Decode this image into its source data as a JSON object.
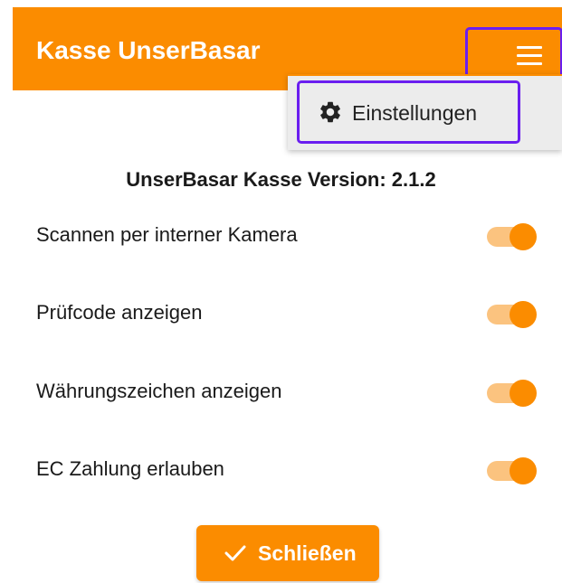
{
  "app_bar": {
    "title": "Kasse UnserBasar",
    "menu_icon": "hamburger-menu-icon",
    "color": "#fb8c00"
  },
  "menu": {
    "items": [
      {
        "icon": "gear-icon",
        "label": "Einstellungen"
      }
    ]
  },
  "version_text": "UnserBasar Kasse Version: 2.1.2",
  "settings": [
    {
      "label": "Scannen per interner Kamera",
      "enabled": true
    },
    {
      "label": "Prüfcode anzeigen",
      "enabled": true
    },
    {
      "label": "Währungszeichen anzeigen",
      "enabled": true
    },
    {
      "label": "EC Zahlung erlauben",
      "enabled": true
    }
  ],
  "close_button": {
    "icon": "check-icon",
    "label": "Schließen"
  },
  "colors": {
    "accent": "#fb8c00",
    "toggle_track": "#fbc37f",
    "highlight": "#6a1ef0"
  }
}
